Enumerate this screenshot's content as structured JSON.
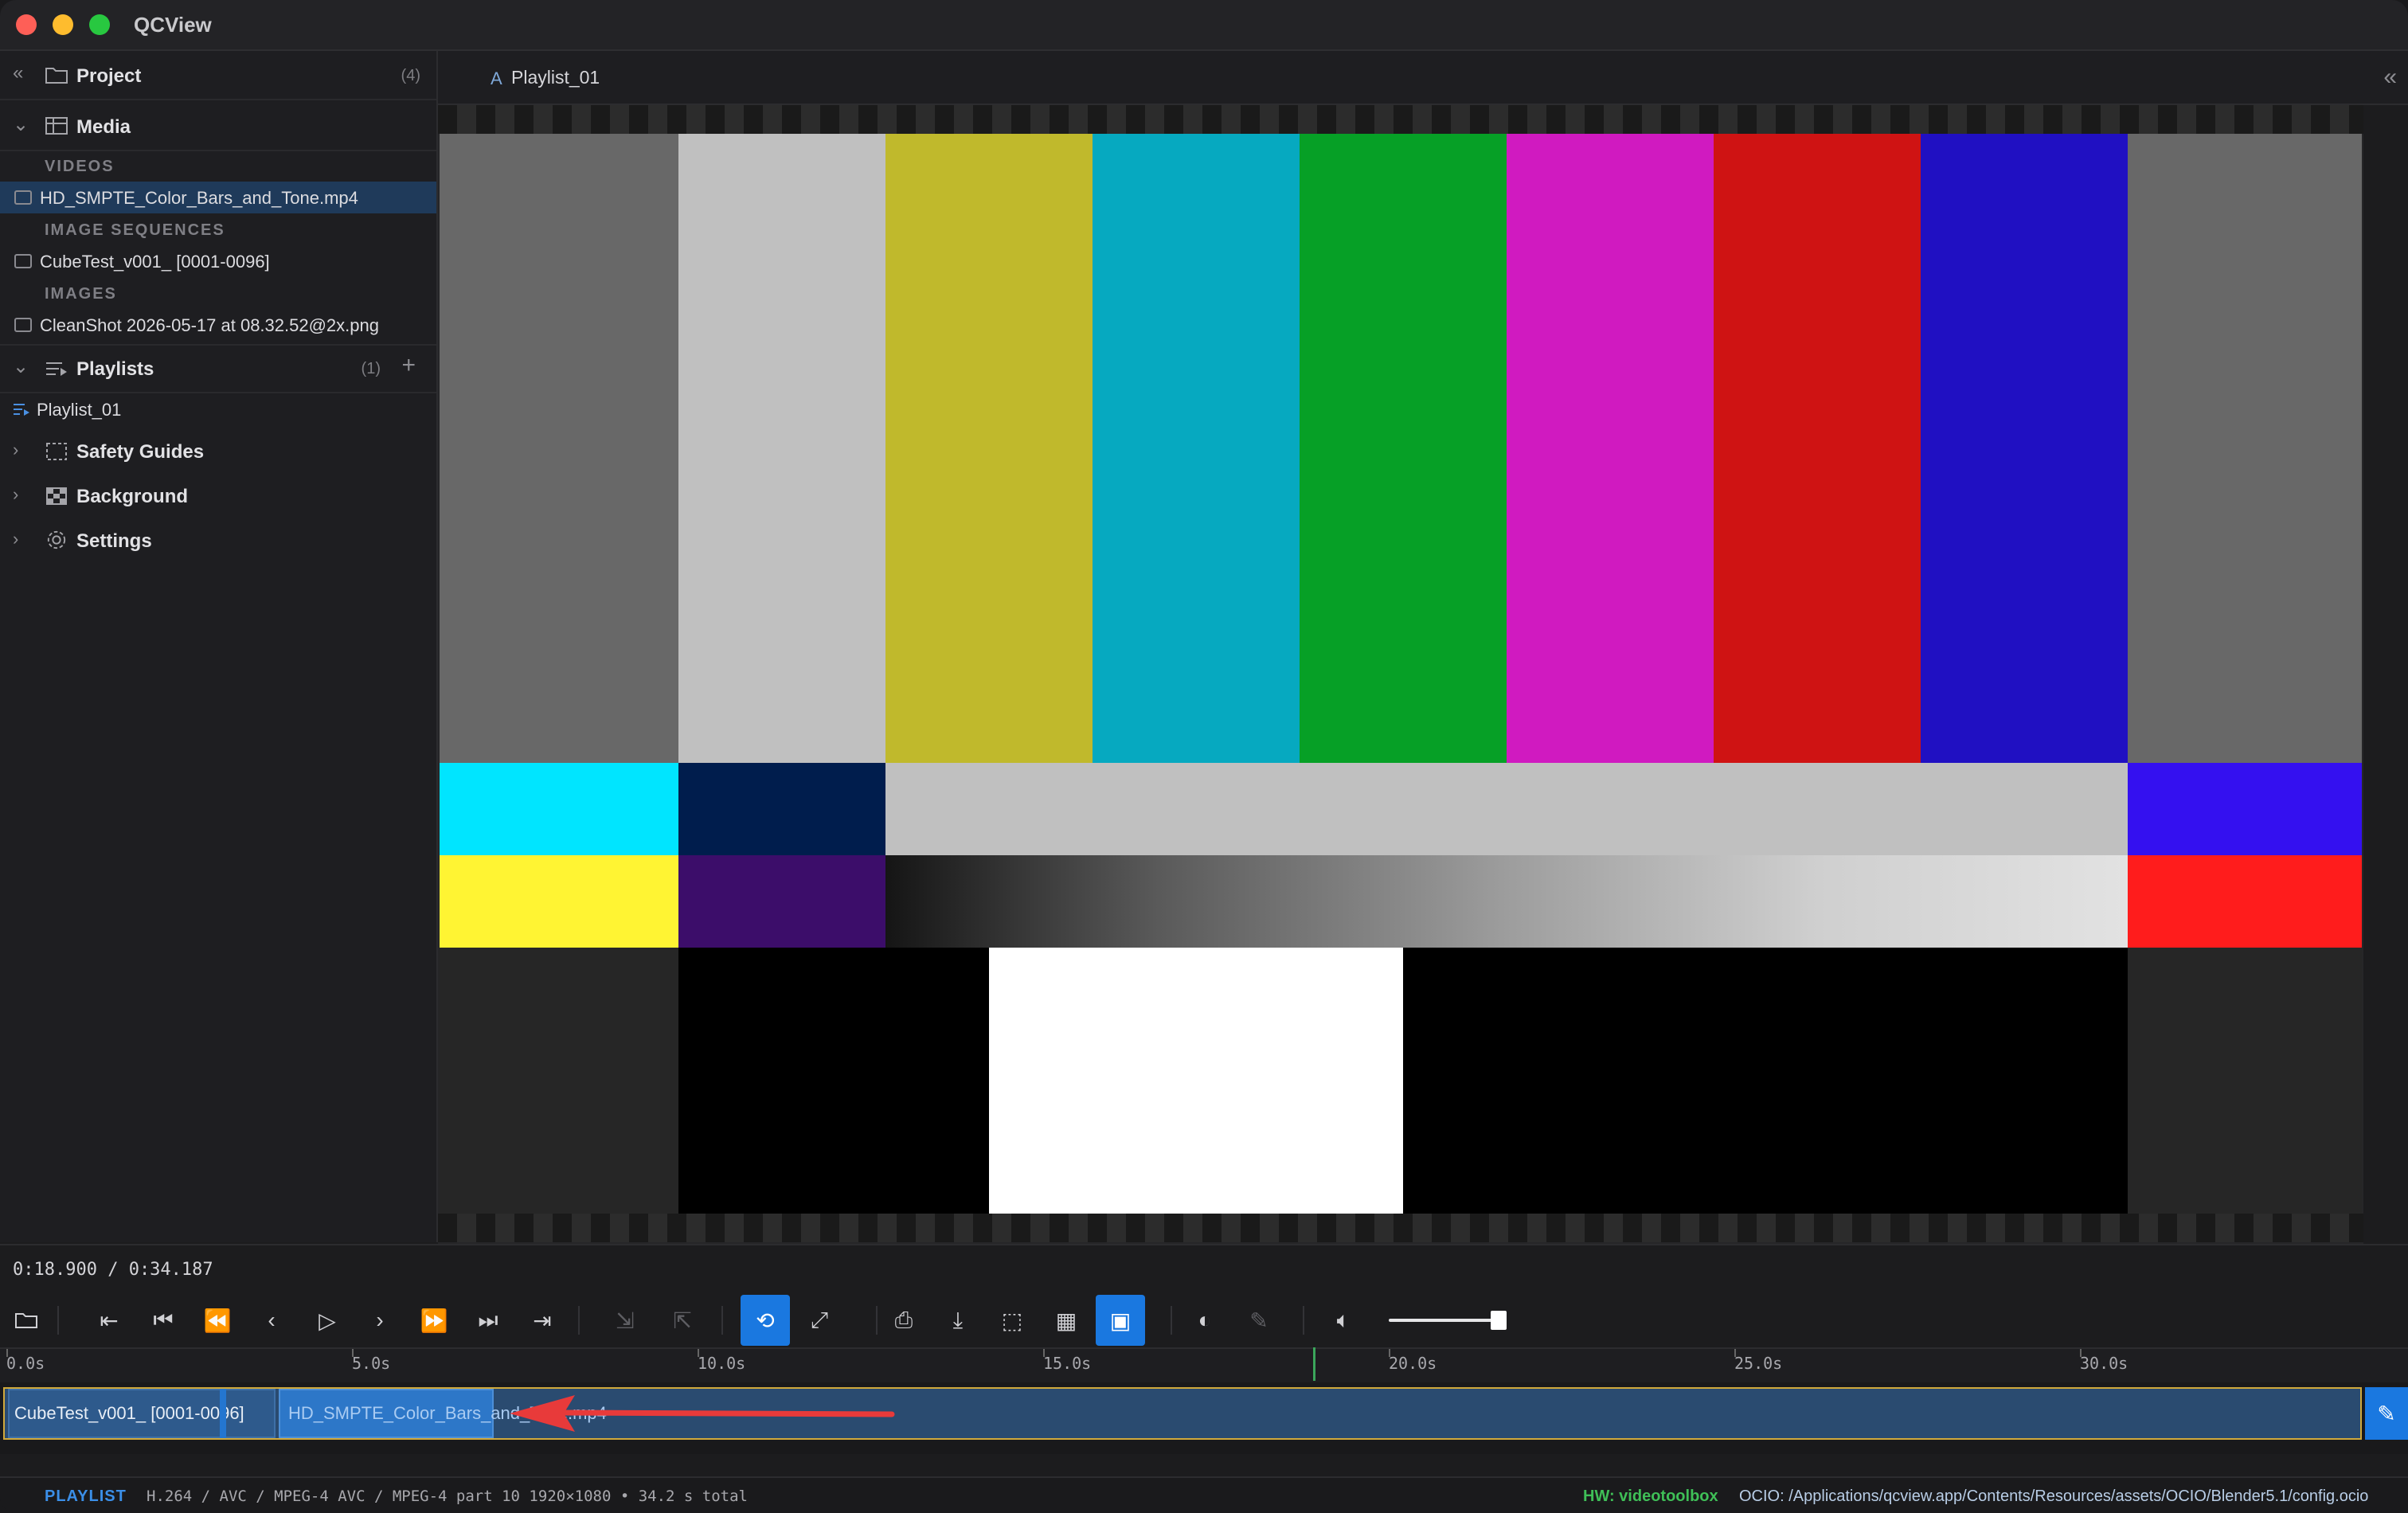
{
  "app": {
    "title": "QCView"
  },
  "sidebar": {
    "project": {
      "label": "Project",
      "count": "(4)"
    },
    "media": {
      "label": "Media",
      "sections": [
        {
          "label": "VIDEOS",
          "items": [
            "HD_SMPTE_Color_Bars_and_Tone.mp4"
          ]
        },
        {
          "label": "IMAGE SEQUENCES",
          "items": [
            "CubeTest_v001_ [0001-0096]"
          ]
        },
        {
          "label": "IMAGES",
          "items": [
            "CleanShot 2026-05-17 at 08.32.52@2x.png"
          ]
        }
      ],
      "selected_item": "HD_SMPTE_Color_Bars_and_Tone.mp4"
    },
    "playlists": {
      "label": "Playlists",
      "count": "(1)",
      "items": [
        "Playlist_01"
      ]
    },
    "safety_guides": {
      "label": "Safety Guides"
    },
    "background": {
      "label": "Background"
    },
    "settings": {
      "label": "Settings"
    }
  },
  "viewer": {
    "tab_prefix": "A",
    "tab_label": "Playlist_01",
    "colors": {
      "top_bars": [
        "#686868",
        "#c0c0c0",
        "#c0b92c",
        "#06a9c0",
        "#06a026",
        "#d01ac0",
        "#cf1313",
        "#2010c2",
        "#686868"
      ],
      "middle_left": [
        "#00e5ff",
        "#001d4d"
      ],
      "middle_center": "#c0c0c0",
      "middle_right": "#3410f0",
      "lower_left": [
        "#fff433",
        "#3c0d6a"
      ],
      "lower_right": "#ff1c1c",
      "bottom_center": "#ffffff",
      "bottom_black": "#000000"
    }
  },
  "transport": {
    "timecode": "0:18.900 / 0:34.187",
    "volume_level": 0.92
  },
  "timeline": {
    "ticks": [
      "0.0s",
      "5.0s",
      "10.0s",
      "15.0s",
      "20.0s",
      "25.0s",
      "30.0s"
    ],
    "playhead_seconds": 18.9,
    "clips": [
      {
        "label": "CubeTest_v001_ [0001-0096]"
      },
      {
        "label": "HD_SMPTE_Color_Bars_and_Tone.mp4"
      }
    ]
  },
  "status": {
    "mode": "PLAYLIST",
    "codec": "H.264 / AVC / MPEG-4 AVC / MPEG-4 part 10   1920×1080   • 34.2 s total",
    "hw": "HW: videotoolbox",
    "ocio": "OCIO: /Applications/qcview.app/Contents/Resources/assets/OCIO/Blender5.1/config.ocio"
  }
}
